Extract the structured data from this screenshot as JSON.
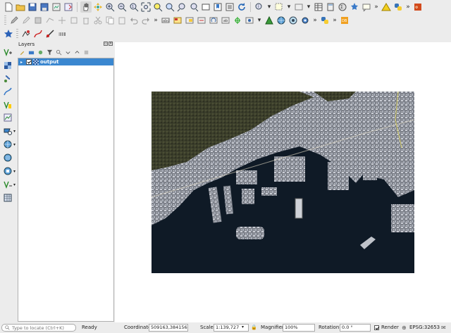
{
  "toolbar": {
    "row1_icons": [
      "new-project-icon",
      "open-project-icon",
      "save-project-icon",
      "save-as-icon",
      "print-layout-icon",
      "layout-manager-icon",
      "pan-hand-icon",
      "pan-to-selection-icon",
      "zoom-in-icon",
      "zoom-out-icon",
      "zoom-native-icon",
      "zoom-full-icon",
      "zoom-to-selection-icon",
      "zoom-to-layer-icon",
      "zoom-last-icon",
      "zoom-next-icon",
      "new-map-view-icon",
      "bookmark-icon",
      "show-bookmarks-icon",
      "refresh-icon",
      "identify-icon",
      "select-icon",
      "deselect-icon",
      "attribute-table-icon",
      "field-calculator-icon",
      "statistics-icon",
      "measure-icon",
      "annotation-icon",
      "plugin-warning-icon",
      "python-icon",
      "tool-red-icon"
    ],
    "row2_icons": [
      "digitize-pencil-icon",
      "toggle-edit-icon",
      "save-edits-icon",
      "add-feature-icon",
      "move-feature-icon",
      "node-tool-icon",
      "delete-selected-icon",
      "cut-icon",
      "copy-icon",
      "paste-icon",
      "undo-icon",
      "redo-icon",
      "label-icon",
      "label-pin-icon",
      "label-highlight-icon",
      "label-move-icon",
      "label-rotate-icon",
      "label-change-icon",
      "gps-icon",
      "label-show-icon",
      "triangle-tool-icon",
      "globe-tool-icon",
      "coordinate-capture-icon",
      "processing-gear-icon",
      "python-console-icon",
      "db-manager-icon"
    ],
    "row3_icons": [
      "star-icon",
      "geometry-checker-icon",
      "digitize-curve-icon",
      "topology-icon",
      "grass-icon"
    ]
  },
  "left_toolbar": {
    "icons": [
      "add-vector-layer-icon",
      "add-raster-layer-icon",
      "add-spatialite-icon",
      "add-postgis-icon",
      "add-wms-icon",
      "add-wcs-icon",
      "add-wfs-icon",
      "add-wmts-icon",
      "add-delimited-text-icon",
      "add-virtual-layer-icon",
      "new-shapefile-icon"
    ]
  },
  "layers_panel": {
    "title": "Layers",
    "layers": [
      {
        "name": "output",
        "checked": true,
        "selected": true
      }
    ]
  },
  "status_bar": {
    "locator_placeholder": "Type to locate (Ctrl+K)",
    "state": "Ready",
    "coordinate_label": "Coordinate",
    "coordinate_value": "509163,3841562",
    "scale_label": "Scale",
    "scale_value": "1:139,727",
    "magnifier_label": "Magnifier",
    "magnifier_value": "100%",
    "rotation_label": "Rotation",
    "rotation_value": "0.0 °",
    "render_label": "Render",
    "render_checked": true,
    "crs_label": "EPSG:32653"
  },
  "colors": {
    "selection_blue": "#3a87d0",
    "water": "#0f1a26"
  }
}
